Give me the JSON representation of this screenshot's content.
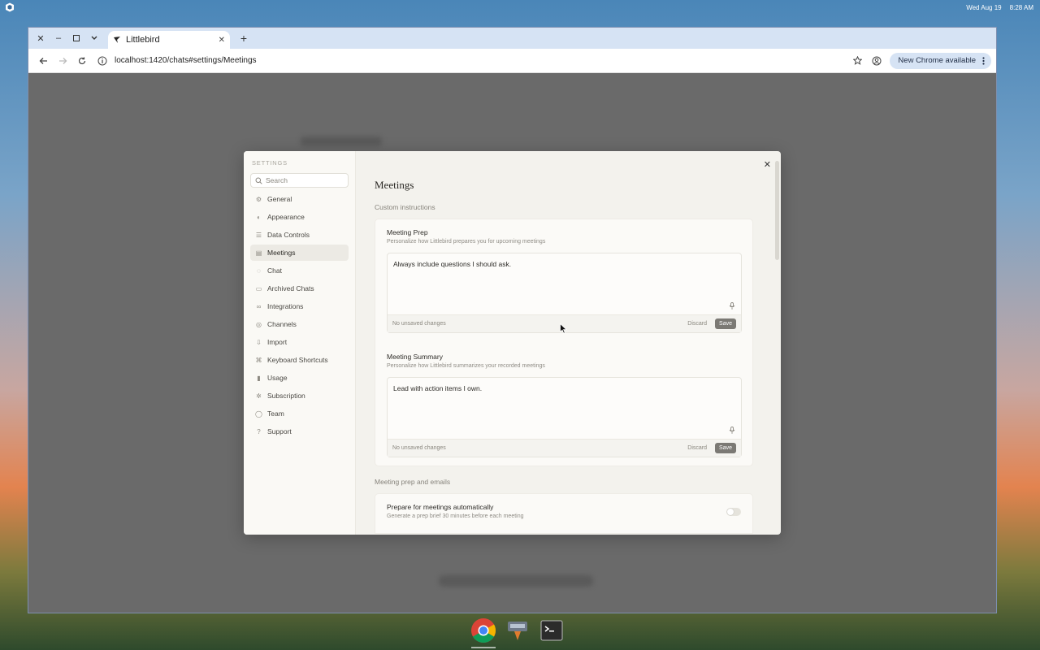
{
  "system": {
    "date": "Wed Aug 19",
    "time": "8:28 AM"
  },
  "browser": {
    "tab_title": "Littlebird",
    "url": "localhost:1420/chats#settings/Meetings",
    "update_label": "New Chrome available"
  },
  "settings": {
    "heading": "SETTINGS",
    "search_placeholder": "Search",
    "nav": [
      {
        "label": "General",
        "icon": "sliders-icon"
      },
      {
        "label": "Appearance",
        "icon": "palette-icon"
      },
      {
        "label": "Data Controls",
        "icon": "database-icon"
      },
      {
        "label": "Meetings",
        "icon": "calendar-icon"
      },
      {
        "label": "Chat",
        "icon": "chat-icon"
      },
      {
        "label": "Archived Chats",
        "icon": "archive-icon"
      },
      {
        "label": "Integrations",
        "icon": "link-icon"
      },
      {
        "label": "Channels",
        "icon": "channels-icon"
      },
      {
        "label": "Import",
        "icon": "import-icon"
      },
      {
        "label": "Keyboard Shortcuts",
        "icon": "command-icon"
      },
      {
        "label": "Usage",
        "icon": "bar-chart-icon"
      },
      {
        "label": "Subscription",
        "icon": "gear-icon"
      },
      {
        "label": "Team",
        "icon": "users-icon"
      },
      {
        "label": "Support",
        "icon": "help-icon"
      }
    ],
    "active_nav": "Meetings"
  },
  "meetings": {
    "title": "Meetings",
    "custom_instructions_label": "Custom instructions",
    "prep": {
      "title": "Meeting Prep",
      "description": "Personalize how Littlebird prepares you for upcoming meetings",
      "value": "Always include questions I should ask.",
      "status": "No unsaved changes",
      "discard": "Discard",
      "save": "Save"
    },
    "summary": {
      "title": "Meeting Summary",
      "description": "Personalize how Littlebird summarizes your recorded meetings",
      "value": "Lead with action items I own.",
      "status": "No unsaved changes",
      "discard": "Discard",
      "save": "Save"
    },
    "prep_emails_label": "Meeting prep and emails",
    "auto_prep": {
      "title": "Prepare for meetings automatically",
      "description": "Generate a prep brief 30 minutes before each meeting",
      "enabled": false
    }
  }
}
